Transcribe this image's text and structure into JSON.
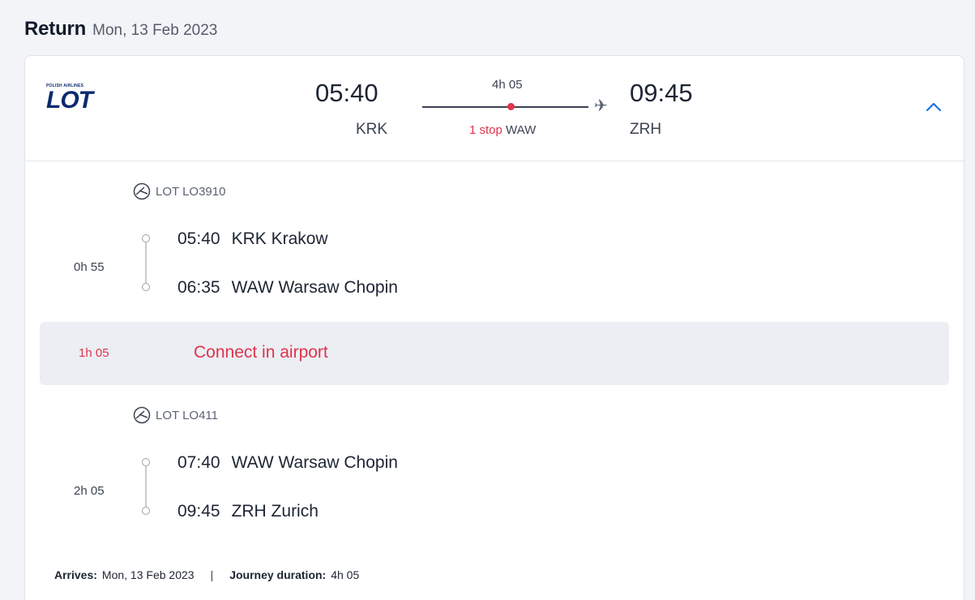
{
  "header": {
    "title": "Return",
    "date": "Mon, 13 Feb 2023"
  },
  "summary": {
    "airline": {
      "logo_text": "LOT",
      "logo_small_text": "POLISH AIRLINES",
      "icon": "lot-logo"
    },
    "departure": {
      "time": "05:40",
      "code": "KRK"
    },
    "arrival": {
      "time": "09:45",
      "code": "ZRH"
    },
    "duration": "4h 05",
    "stops_label": "1 stop",
    "stop_airport": "WAW",
    "plane_icon": "plane-icon",
    "expand_icon": "chevron-up-icon",
    "accent_color": "#e0334c",
    "link_color": "#1a73e8"
  },
  "segments": [
    {
      "carrier": "LOT LO3910",
      "duration": "0h 55",
      "from": {
        "time": "05:40",
        "place": "KRK Krakow"
      },
      "to": {
        "time": "06:35",
        "place": "WAW Warsaw Chopin"
      }
    },
    {
      "carrier": "LOT LO411",
      "duration": "2h 05",
      "from": {
        "time": "07:40",
        "place": "WAW Warsaw Chopin"
      },
      "to": {
        "time": "09:45",
        "place": "ZRH Zurich"
      }
    }
  ],
  "connection": {
    "duration": "1h 05",
    "text": "Connect in airport"
  },
  "footer": {
    "arrives_label": "Arrives:",
    "arrives_value": "Mon, 13 Feb 2023",
    "separator": "|",
    "journey_label": "Journey duration:",
    "journey_value": "4h 05"
  }
}
